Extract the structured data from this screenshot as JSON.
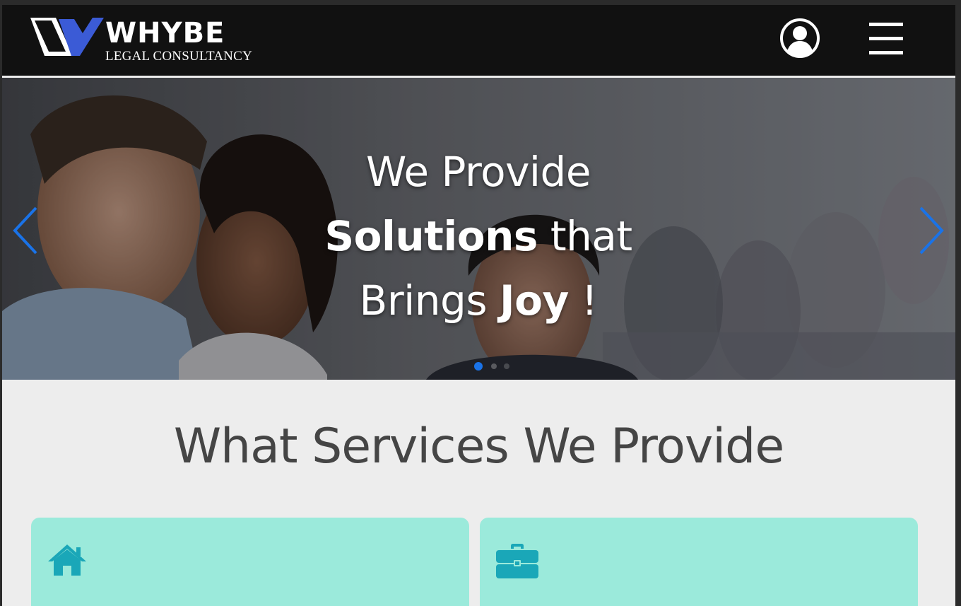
{
  "header": {
    "brand_name": "WHYBE",
    "brand_subtitle": "LEGAL CONSULTANCY",
    "user_icon": "user-circle-icon",
    "menu_icon": "hamburger-menu-icon",
    "accent_color": "#3b5bd6"
  },
  "hero": {
    "line1": "We Provide",
    "line2_bold": "Solutions",
    "line2_rest": " that",
    "line3_start": "Brings ",
    "line3_bold": "Joy",
    "line3_end": " !",
    "prev_icon": "chevron-left-icon",
    "next_icon": "chevron-right-icon",
    "active_slide": 1,
    "arrow_color": "#1a73e8"
  },
  "services": {
    "title": "What Services We Provide",
    "cards": [
      {
        "icon": "home-icon"
      },
      {
        "icon": "briefcase-icon"
      }
    ],
    "card_color": "#9beadb",
    "icon_color": "#1aa7b8"
  }
}
